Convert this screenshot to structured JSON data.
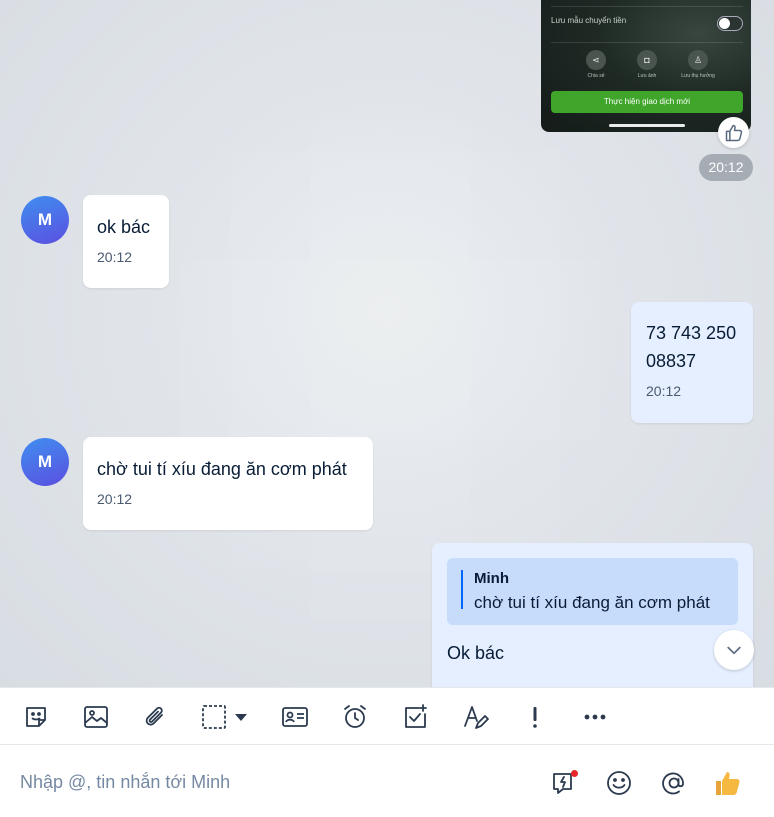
{
  "conversation": {
    "partner_name": "Minh",
    "avatar_initial": "M"
  },
  "image_message": {
    "toggle_label": "Lưu mẫu chuyển tiền",
    "actions": [
      "Chia sẻ",
      "Lưu ảnh",
      "Lưu thụ hưởng"
    ],
    "cta_label": "Thực hiện giao dịch mới",
    "time": "20:12"
  },
  "messages": [
    {
      "direction": "in",
      "text": "ok bác",
      "time": "20:12"
    },
    {
      "direction": "out",
      "text_line1": "73 743 250",
      "text_line2": "08837",
      "time": "20:12"
    },
    {
      "direction": "in",
      "text": "chờ tui tí xíu đang ăn cơm phát",
      "time": "20:12"
    },
    {
      "direction": "out",
      "quote_name": "Minh",
      "quote_text": "chờ tui tí xíu đang ăn cơm phát",
      "text": "Ok bác"
    }
  ],
  "toolbar": {
    "icons": [
      "sticker-icon",
      "image-icon",
      "attachment-icon",
      "screenshot-icon",
      "contact-card-icon",
      "reminder-icon",
      "todo-icon",
      "text-format-icon",
      "urgent-icon",
      "more-icon"
    ]
  },
  "composer": {
    "placeholder": "Nhập @, tin nhắn tới Minh"
  },
  "colors": {
    "accent": "#0068ff",
    "out_bubble": "#e5efff",
    "quote_bg": "#c7dcfb",
    "cta_green": "#3fa62b"
  }
}
